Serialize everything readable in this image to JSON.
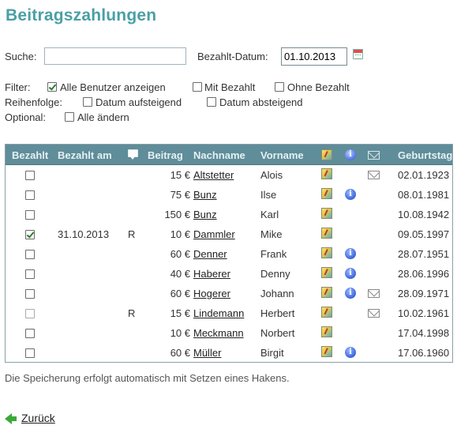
{
  "page": {
    "title": "Beitragszahlungen"
  },
  "search": {
    "label": "Suche:",
    "value": "",
    "placeholder": ""
  },
  "date": {
    "label": "Bezahlt-Datum:",
    "value": "01.10.2013"
  },
  "filter": {
    "label": "Filter:",
    "options": [
      {
        "label": "Alle Benutzer anzeigen",
        "checked": true
      },
      {
        "label": "Mit Bezahlt",
        "checked": false
      },
      {
        "label": "Ohne Bezahlt",
        "checked": false
      }
    ]
  },
  "order": {
    "label": "Reihenfolge:",
    "options": [
      {
        "label": "Datum aufsteigend",
        "checked": false
      },
      {
        "label": "Datum absteigend",
        "checked": false
      }
    ]
  },
  "optional": {
    "label": "Optional:",
    "options": [
      {
        "label": "Alle ändern",
        "checked": false
      }
    ]
  },
  "table": {
    "headers": {
      "paid": "Bezahlt",
      "paid_at": "Bezahlt am",
      "comment_icon": "comment-icon",
      "fee": "Beitrag",
      "lastname": "Nachname",
      "firstname": "Vorname",
      "map_icon": "map-icon",
      "info_icon": "info-icon",
      "mail_icon": "mail-icon",
      "birthday": "Geburtstag"
    },
    "rows": [
      {
        "paid": false,
        "paid_at": "",
        "comment": "",
        "fee": "15 €",
        "lastname": "Altstetter",
        "firstname": "Alois",
        "map": true,
        "info": false,
        "mail": true,
        "birthday": "02.01.1923"
      },
      {
        "paid": false,
        "paid_at": "",
        "comment": "",
        "fee": "75 €",
        "lastname": "Bunz",
        "firstname": "Ilse",
        "map": true,
        "info": true,
        "mail": false,
        "birthday": "08.01.1981"
      },
      {
        "paid": false,
        "paid_at": "",
        "comment": "",
        "fee": "150 €",
        "lastname": "Bunz",
        "firstname": "Karl",
        "map": true,
        "info": false,
        "mail": false,
        "birthday": "10.08.1942"
      },
      {
        "paid": true,
        "paid_at": "31.10.2013",
        "comment": "R",
        "fee": "10 €",
        "lastname": "Dammler",
        "firstname": "Mike",
        "map": true,
        "info": false,
        "mail": false,
        "birthday": "09.05.1997"
      },
      {
        "paid": false,
        "paid_at": "",
        "comment": "",
        "fee": "60 €",
        "lastname": "Denner",
        "firstname": "Frank",
        "map": true,
        "info": true,
        "mail": false,
        "birthday": "28.07.1951"
      },
      {
        "paid": false,
        "paid_at": "",
        "comment": "",
        "fee": "40 €",
        "lastname": "Haberer",
        "firstname": "Denny",
        "map": true,
        "info": true,
        "mail": false,
        "birthday": "28.06.1996"
      },
      {
        "paid": false,
        "paid_at": "",
        "comment": "",
        "fee": "60 €",
        "lastname": "Hogerer",
        "firstname": "Johann",
        "map": true,
        "info": true,
        "mail": true,
        "birthday": "28.09.1971"
      },
      {
        "paid": false,
        "paid_at": "",
        "comment": "R",
        "fee": "15 €",
        "lastname": "Lindemann",
        "firstname": "Herbert",
        "map": true,
        "info": false,
        "mail": true,
        "birthday": "10.02.1961",
        "faded": true
      },
      {
        "paid": false,
        "paid_at": "",
        "comment": "",
        "fee": "10 €",
        "lastname": "Meckmann",
        "firstname": "Norbert",
        "map": true,
        "info": false,
        "mail": false,
        "birthday": "17.04.1998"
      },
      {
        "paid": false,
        "paid_at": "",
        "comment": "",
        "fee": "60 €",
        "lastname": "Müller",
        "firstname": "Birgit",
        "map": true,
        "info": true,
        "mail": false,
        "birthday": "17.06.1960"
      }
    ]
  },
  "footer": {
    "note": "Die Speicherung erfolgt automatisch mit Setzen eines Hakens.",
    "back_label": "Zurück"
  },
  "colors": {
    "title": "#4a9fa6",
    "header_bg": "#5f8d9a",
    "check": "#2e7d32"
  }
}
